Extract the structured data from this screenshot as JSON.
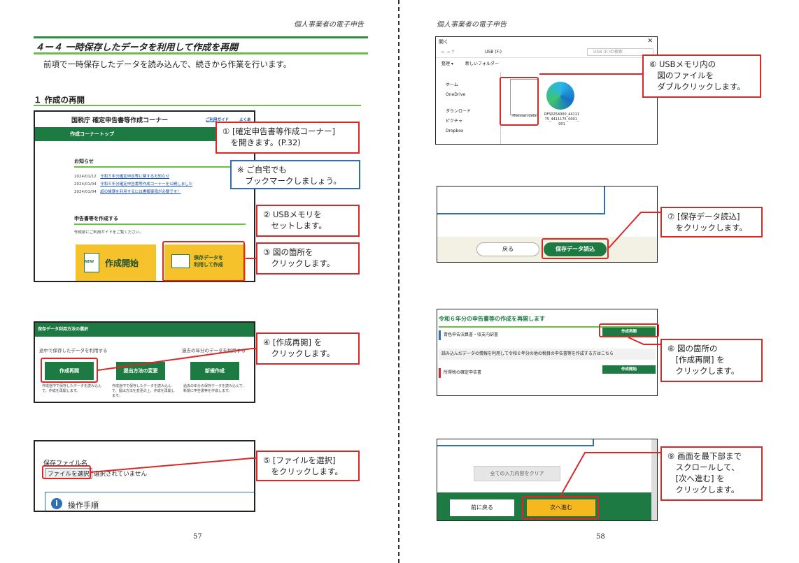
{
  "running_head": "個人事業者の電子申告",
  "left_page": {
    "section_title": "４ー４ 一時保存したデータを利用して作成を再開",
    "intro": "前項で一時保存したデータを読み込んで、続きから作業を行います。",
    "subhead": "１ 作成の再開",
    "page_number": "57",
    "shot1": {
      "site_title": "国税庁 確定申告書等作成コーナー",
      "help_link": "ご利用ガイド",
      "faq_link": "よくあ",
      "nav": "作成コーナートップ",
      "news_title": "お知らせ",
      "news": [
        {
          "date": "2024/01/12",
          "text": "令和５年分確定申告等に関するお知らせ"
        },
        {
          "date": "2024/01/04",
          "text": "令和５年分確定申告書等作成コーナーを公開しました"
        },
        {
          "date": "2024/01/04",
          "text": "紙の帳簿を利用するには書類事項が必要です！"
        }
      ],
      "create_title": "申告書等を作成する",
      "create_note": "作成前にご利用ガイドをご覧ください。",
      "new_badge": "NEW",
      "start_label": "作成開始",
      "resume_label": "保存データを\n利用して作成"
    },
    "callouts": {
      "c1": "① [確定申告書等作成コーナー]\n　を開きます。(P.32)",
      "note": "※ ご自宅でも\n　ブックマークしましょう。",
      "c2": "② USBメモリを\n　セットします。",
      "c3": "③ 図の箇所を\n　クリックします。",
      "c4": "④ [作成再開] を\n　クリックします。",
      "c5": "⑤ [ファイルを選択]\n　をクリックします。"
    },
    "shot2": {
      "header": "保存データ利用方法の選択",
      "col1_title": "途中で保存したデータを利用する",
      "col3_title": "過去の年分のデータを利用する",
      "btn1": "作成再開",
      "btn2": "提出方法の変更",
      "btn3": "新規作成",
      "desc1": "作成途中で保存したデータを読み込んで、作成を再開します。",
      "desc2": "作成途中で保存したデータを読み込んで、提出方法を変更の上、作成を再開します。",
      "desc3": "過去の年分の保存データを読み込んで、新規に申告書等を作成します。"
    },
    "shot3": {
      "label": "保存ファイル名",
      "button": "ファイルを選択",
      "status": "選択されていません",
      "info": "操作手順"
    }
  },
  "right_page": {
    "page_number": "58",
    "shot6": {
      "title": "開く",
      "path": "USB (F:)",
      "search_placeholder": "USB (F:)の検索",
      "organize": "整理 ▾",
      "new_folder": "新しいフォルダー",
      "nav_items": [
        "ホーム",
        "OneDrive",
        "ダウンロード",
        "ピクチャ",
        "Dropbox"
      ],
      "file1": "r6kessan.data",
      "file2": "RFS0254000_4411175_4411175_0001_001"
    },
    "callouts": {
      "c6": "⑥ USBメモリ内の\n　図のファイルを\n　ダブルクリックします。",
      "c7": "⑦ [保存データ読込]\n　をクリックします。",
      "c8": "⑧ 図の箇所の\n　[作成再開] を\n　クリックします。",
      "c9": "⑨ 画面を最下部まで\n　スクロールして、\n　[次へ進む] を\n　クリックします。"
    },
    "shot7": {
      "back": "戻る",
      "load": "保存データ読込"
    },
    "shot8": {
      "title": "令和６年分の申告書等の作成を再開します",
      "row1": "青色申告決算書・収支内訳書",
      "row1_btn": "作成再開",
      "row2": "読み込んだデータの情報を利用して令和６年分の他の税目の申告書等を作成する方はこちら",
      "row3": "所得税の確定申告書",
      "row3_btn": "作成開始"
    },
    "shot9": {
      "clear": "全ての入力内容をクリア",
      "prev": "前に戻る",
      "next": "次へ進む"
    }
  },
  "colors": {
    "accent_green": "#1e7a43",
    "callout_red": "#d82929",
    "note_blue": "#2f6fb5",
    "card_yellow": "#f5c22b"
  }
}
